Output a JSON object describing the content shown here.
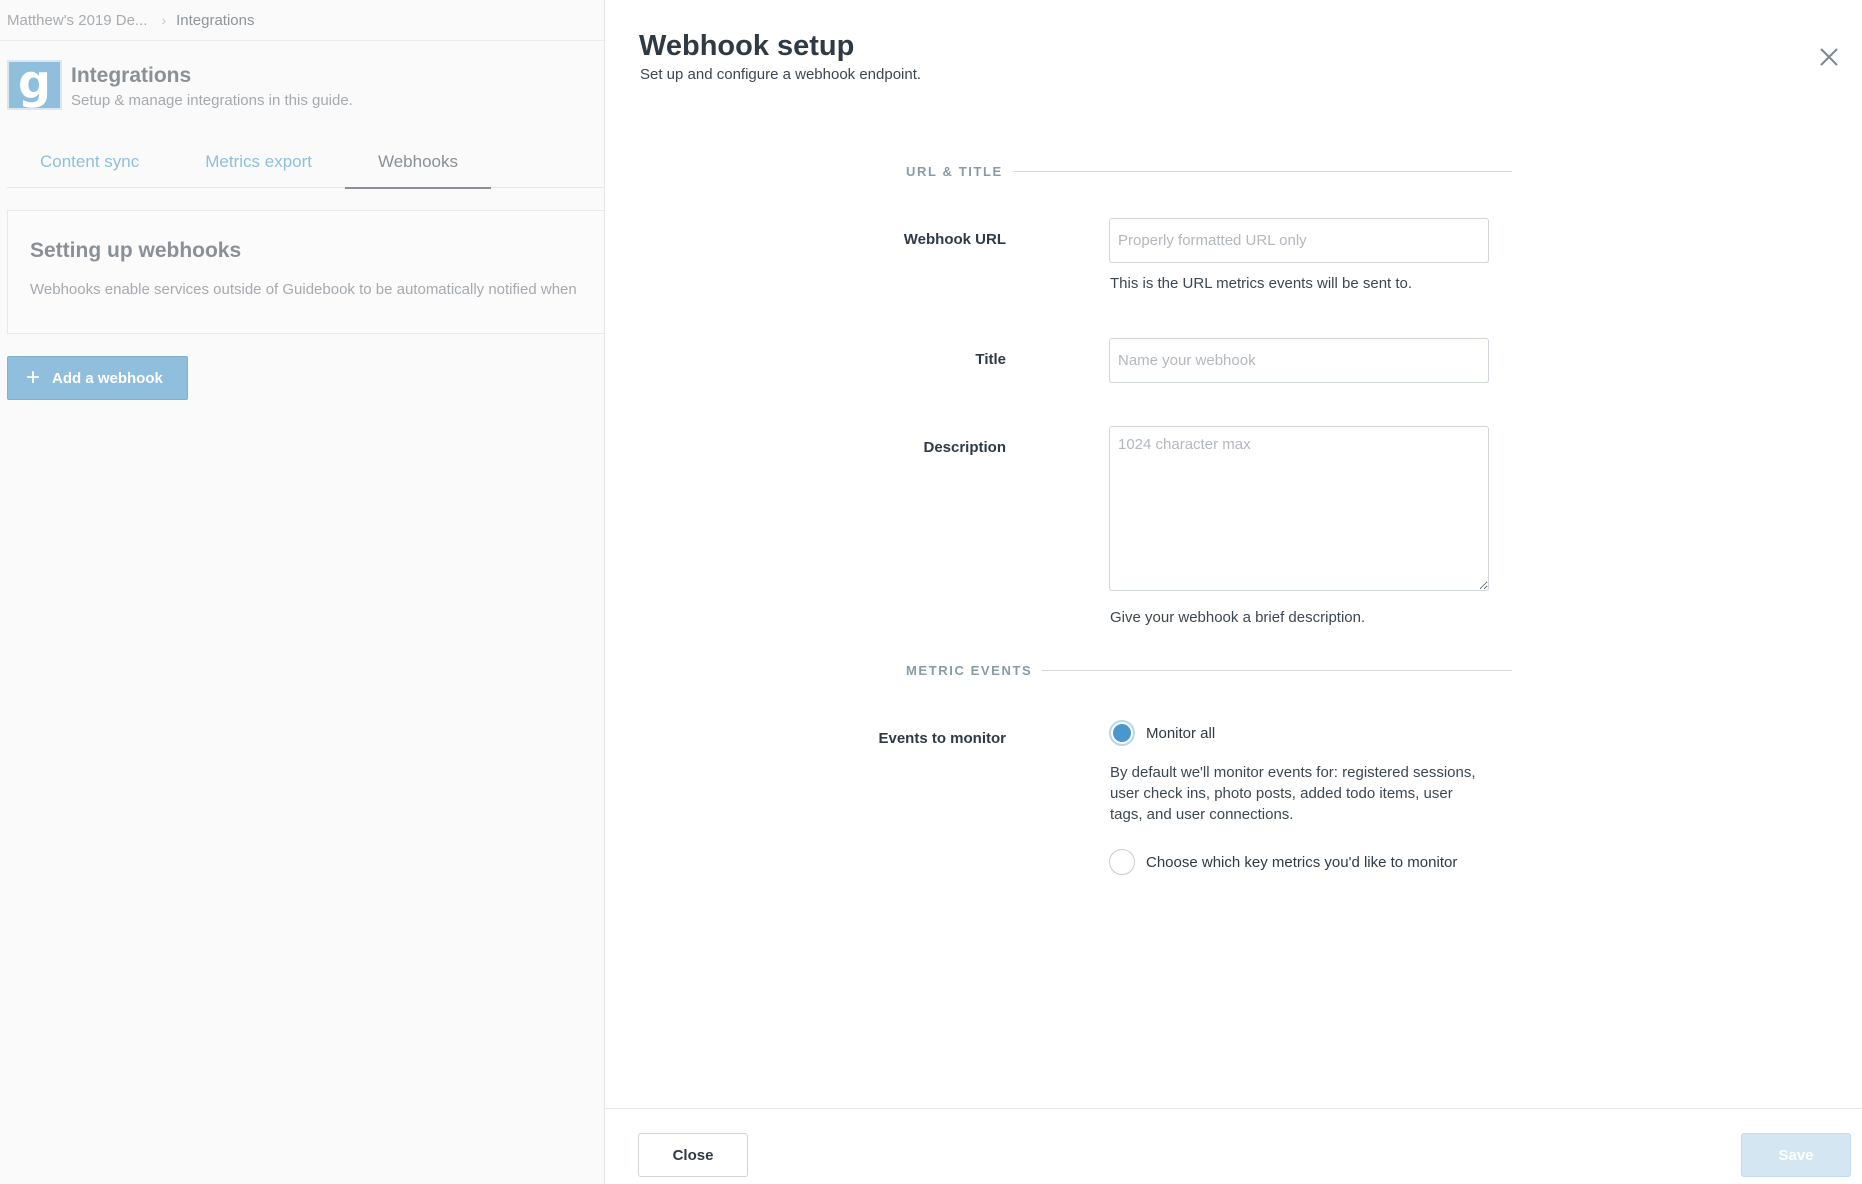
{
  "breadcrumb": {
    "parent": "Matthew's 2019 De...",
    "current": "Integrations"
  },
  "page": {
    "logo_letter": "g",
    "title": "Integrations",
    "subtitle": "Setup & manage integrations in this guide."
  },
  "tabs": [
    {
      "label": "Content sync"
    },
    {
      "label": "Metrics export"
    },
    {
      "label": "Webhooks"
    }
  ],
  "info_card": {
    "title": "Setting up webhooks",
    "text": "Webhooks enable services outside of Guidebook to be automatically notified when"
  },
  "add_button": {
    "icon": "plus-icon",
    "label": "Add a webhook"
  },
  "modal": {
    "title": "Webhook setup",
    "subtitle": "Set up and configure a webhook endpoint.",
    "close_icon": "close-icon",
    "sections": {
      "url_title": "URL & TITLE",
      "metric_events": "METRIC EVENTS"
    },
    "fields": {
      "webhook_url": {
        "label": "Webhook URL",
        "value": "",
        "placeholder": "Properly formatted URL only",
        "help": "This is the URL metrics events will be sent to."
      },
      "title": {
        "label": "Title",
        "value": "",
        "placeholder": "Name your webhook"
      },
      "description": {
        "label": "Description",
        "value": "",
        "placeholder": "1024 character max",
        "help": "Give your webhook a brief description."
      }
    },
    "events": {
      "label": "Events to monitor",
      "options": [
        {
          "label": "Monitor all",
          "selected": true
        },
        {
          "label": "Choose which key metrics you'd like to monitor",
          "selected": false
        }
      ],
      "monitor_all_help": "By default we'll monitor events for: registered sessions, user check ins, photo posts, added todo items, user tags, and user connections."
    },
    "footer": {
      "close_label": "Close",
      "save_label": "Save"
    }
  },
  "colors": {
    "accent": "#4a97cf",
    "muted_accent": "#8fbfdc",
    "save_disabled": "#d3e6f2"
  }
}
